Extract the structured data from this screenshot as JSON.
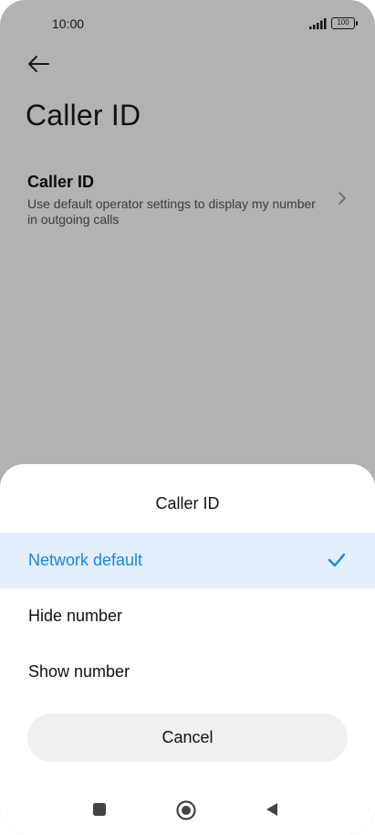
{
  "status_bar": {
    "time": "10:00",
    "battery": "100",
    "icons": [
      "camera-cutout",
      "signal-icon",
      "battery-icon"
    ]
  },
  "header": {
    "back_icon": "arrow-left-icon",
    "title": "Caller ID"
  },
  "setting": {
    "title": "Caller ID",
    "description": "Use default operator settings to display my number in outgoing calls",
    "chevron_icon": "chevron-right-icon"
  },
  "sheet": {
    "title": "Caller ID",
    "options": [
      {
        "label": "Network default",
        "selected": true
      },
      {
        "label": "Hide number",
        "selected": false
      },
      {
        "label": "Show number",
        "selected": false
      }
    ],
    "check_icon": "checkmark-icon",
    "cancel_label": "Cancel"
  },
  "nav_bar": {
    "icons": [
      "recents-square-icon",
      "home-circle-icon",
      "back-triangle-icon"
    ]
  },
  "colors": {
    "accent": "#1a86e0",
    "selected_bg": "#e3effc",
    "scrim": "rgba(0,0,0,0.30)",
    "cancel_bg": "#f0f0f0"
  }
}
